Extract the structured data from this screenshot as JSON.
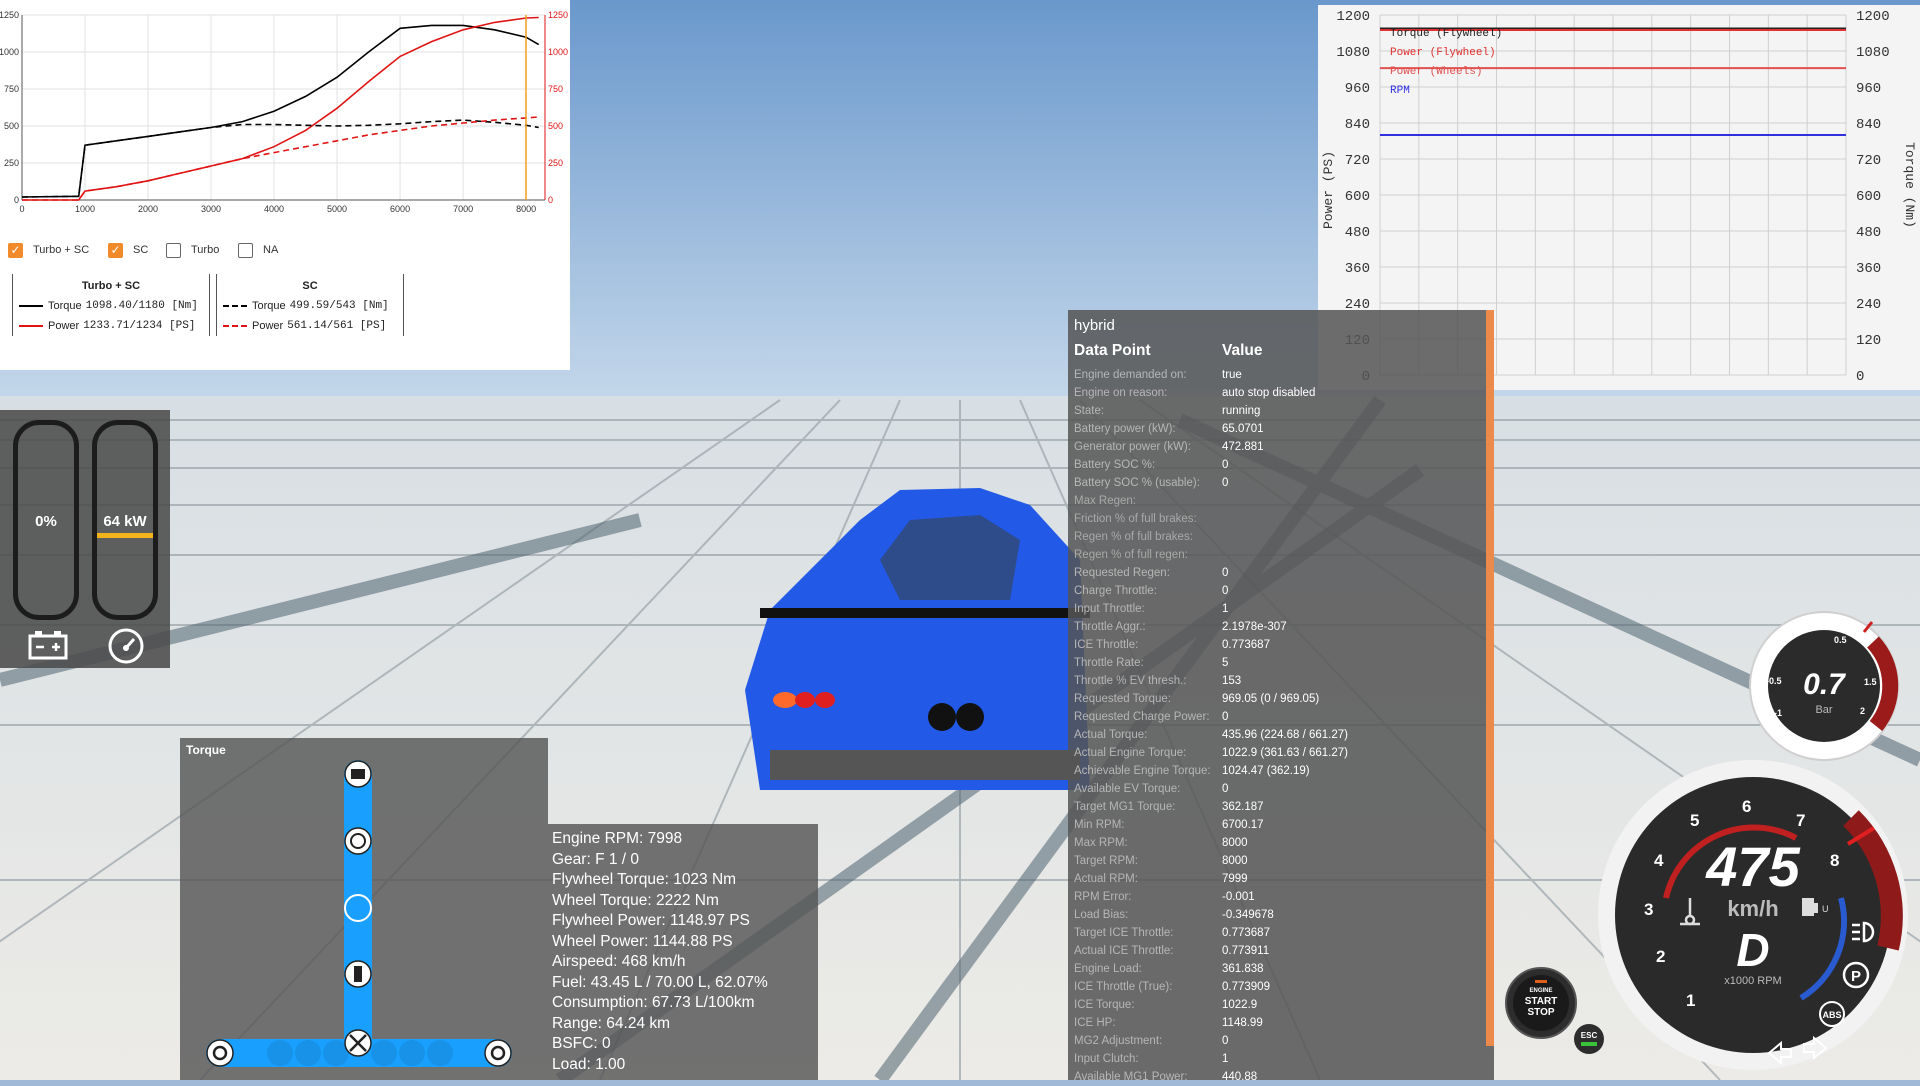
{
  "dyno": {
    "x_ticks": [
      "0",
      "1000",
      "2000",
      "3000",
      "4000",
      "5000",
      "6000",
      "7000",
      "8000"
    ],
    "y_left_ticks": [
      "0",
      "250",
      "500",
      "750",
      "1000",
      "1250"
    ],
    "y_right_ticks": [
      "0",
      "250",
      "500",
      "750",
      "1000",
      "1250"
    ],
    "checkboxes": [
      {
        "label": "Turbo + SC",
        "checked": true
      },
      {
        "label": "SC",
        "checked": true
      },
      {
        "label": "Turbo",
        "checked": false
      },
      {
        "label": "NA",
        "checked": false
      }
    ],
    "legend": [
      {
        "title": "Turbo + SC",
        "torque_label": "Torque",
        "torque_value": "1098.40/1180 [Nm]",
        "power_label": "Power",
        "power_value": "1233.71/1234 [PS]"
      },
      {
        "title": "SC",
        "torque_label": "Torque",
        "torque_value": "499.59/543 [Nm]",
        "power_label": "Power",
        "power_value": "561.14/561 [PS]"
      }
    ],
    "colors": {
      "torque": "#000000",
      "power": "#e01414",
      "marker": "#f0a020"
    }
  },
  "chart_data": [
    {
      "type": "line",
      "x": [
        0,
        900,
        1000,
        1500,
        2000,
        2500,
        3000,
        3500,
        4000,
        4500,
        5000,
        5500,
        6000,
        6500,
        7000,
        7500,
        8000,
        8200
      ],
      "series": [
        {
          "name": "Turbo + SC Torque",
          "values": [
            20,
            25,
            370,
            400,
            430,
            460,
            490,
            530,
            600,
            700,
            830,
            1000,
            1160,
            1180,
            1180,
            1150,
            1100,
            1050
          ]
        },
        {
          "name": "Turbo + SC Power",
          "values": [
            0,
            0,
            60,
            90,
            130,
            180,
            230,
            280,
            360,
            470,
            620,
            800,
            970,
            1070,
            1150,
            1200,
            1230,
            1233
          ]
        },
        {
          "name": "SC Torque",
          "values": [
            20,
            25,
            370,
            400,
            430,
            460,
            490,
            510,
            510,
            505,
            500,
            505,
            515,
            530,
            540,
            525,
            505,
            490
          ]
        },
        {
          "name": "SC Power",
          "values": [
            0,
            0,
            60,
            90,
            130,
            180,
            230,
            280,
            320,
            360,
            400,
            440,
            470,
            500,
            520,
            540,
            555,
            561
          ]
        }
      ],
      "xlim": [
        0,
        8300
      ],
      "ylim": [
        0,
        1250
      ],
      "marker_x": 7998,
      "grid": true
    },
    {
      "type": "line",
      "series": [
        {
          "name": "Torque (Flywheel)",
          "values": [
            1023,
            1023
          ]
        },
        {
          "name": "Power (Flywheel)",
          "values": [
            1148.97,
            1148.97
          ]
        },
        {
          "name": "Power (Wheels)",
          "values": [
            1144.88,
            1144.88
          ]
        },
        {
          "name": "RPM",
          "values": [
            7998,
            7998
          ]
        }
      ],
      "ylabel": "Power (PS)",
      "ylabel_right": "Torque (Nm)",
      "y_ticks": [
        "0",
        "120",
        "240",
        "360",
        "480",
        "600",
        "720",
        "840",
        "960",
        "1080",
        "1200"
      ],
      "ylim": [
        0,
        1200
      ],
      "grid": true,
      "legend_position": "top-left"
    }
  ],
  "graph_legend": [
    {
      "label": "Torque (Flywheel)",
      "color": "#222222"
    },
    {
      "label": "Power (Flywheel)",
      "color": "#e03030"
    },
    {
      "label": "Power (Wheels)",
      "color": "#e05050"
    },
    {
      "label": "RPM",
      "color": "#3030e0"
    }
  ],
  "graph_axes": {
    "left_label": "Power (PS)",
    "right_label": "Torque (Nm)"
  },
  "ev_gauges": {
    "battery_label": "0%",
    "power_label": "64 kW",
    "power_level": 0.5,
    "bar_color": "#f3b41b"
  },
  "torque_diagram": {
    "title": "Torque"
  },
  "stats": [
    "Engine RPM: 7998",
    "Gear: F 1 / 0",
    "Flywheel Torque: 1023 Nm",
    "Wheel Torque: 2222 Nm",
    "Flywheel Power: 1148.97 PS",
    "Wheel Power: 1144.88 PS",
    "Airspeed: 468 km/h",
    "Fuel: 43.45 L / 70.00 L, 62.07%",
    "Consumption: 67.73 L/100km",
    "Range: 64.24 km",
    "BSFC: 0",
    "Load: 1.00"
  ],
  "hybrid": {
    "title": "hybrid",
    "col_key": "Data Point",
    "col_value": "Value",
    "rows": [
      {
        "k": "Engine demanded on:",
        "v": "true"
      },
      {
        "k": "Engine on reason:",
        "v": "auto stop disabled"
      },
      {
        "k": "State:",
        "v": "running"
      },
      {
        "k": "Battery power (kW):",
        "v": "65.0701"
      },
      {
        "k": "Generator power (kW):",
        "v": "472.881"
      },
      {
        "k": "Battery SOC %:",
        "v": "0"
      },
      {
        "k": "Battery SOC % (usable):",
        "v": "0"
      },
      {
        "k": "Max Regen:",
        "v": ""
      },
      {
        "k": "Friction % of full brakes:",
        "v": ""
      },
      {
        "k": "Regen % of full brakes:",
        "v": ""
      },
      {
        "k": "Regen % of full regen:",
        "v": ""
      },
      {
        "k": "Requested Regen:",
        "v": "0"
      },
      {
        "k": "Charge Throttle:",
        "v": "0"
      },
      {
        "k": "Input Throttle:",
        "v": "1"
      },
      {
        "k": "Throttle Aggr.:",
        "v": "2.1978e-307"
      },
      {
        "k": "ICE Throttle:",
        "v": "0.773687"
      },
      {
        "k": "Throttle Rate:",
        "v": "5"
      },
      {
        "k": "Throttle % EV thresh.:",
        "v": "153"
      },
      {
        "k": "Requested Torque:",
        "v": "969.05 (0 / 969.05)"
      },
      {
        "k": "Requested Charge Power:",
        "v": "0"
      },
      {
        "k": "Actual Torque:",
        "v": "435.96 (224.68 / 661.27)"
      },
      {
        "k": "Actual Engine Torque:",
        "v": "1022.9 (361.63 / 661.27)"
      },
      {
        "k": "Achievable Engine Torque:",
        "v": "1024.47 (362.19)"
      },
      {
        "k": "Available EV Torque:",
        "v": "0"
      },
      {
        "k": "Target MG1 Torque:",
        "v": "362.187"
      },
      {
        "k": "Min RPM:",
        "v": "6700.17"
      },
      {
        "k": "Max RPM:",
        "v": "8000"
      },
      {
        "k": "Target RPM:",
        "v": "8000"
      },
      {
        "k": "Actual RPM:",
        "v": "7999"
      },
      {
        "k": "RPM Error:",
        "v": "-0.001"
      },
      {
        "k": "Load Bias:",
        "v": "-0.349678"
      },
      {
        "k": "Target ICE Throttle:",
        "v": "0.773687"
      },
      {
        "k": "Actual ICE Throttle:",
        "v": "0.773911"
      },
      {
        "k": "Engine Load:",
        "v": "361.838"
      },
      {
        "k": "ICE Throttle (True):",
        "v": "0.773909"
      },
      {
        "k": "ICE Torque:",
        "v": "1022.9"
      },
      {
        "k": "ICE HP:",
        "v": "1148.99"
      },
      {
        "k": "MG2 Adjustment:",
        "v": "0"
      },
      {
        "k": "Input Clutch:",
        "v": "1"
      },
      {
        "k": "Available MG1 Power:",
        "v": "440.88"
      }
    ]
  },
  "boost": {
    "value": "0.7",
    "unit": "Bar",
    "ticks": [
      "-1",
      "-0.5",
      "0.5",
      "1.5",
      "2"
    ]
  },
  "speedo": {
    "speed": "475",
    "unit": "km/h",
    "gear": "D",
    "rpm_caption": "x1000 RPM",
    "ticks": [
      "1",
      "2",
      "3",
      "4",
      "5",
      "6",
      "7",
      "8"
    ],
    "fuel_mark": "U"
  },
  "engine_button": {
    "line1": "ENGINE",
    "line2": "START",
    "line3": "STOP"
  },
  "esc": {
    "label": "ESC"
  },
  "abs": {
    "label": "ABS"
  },
  "park": {
    "label": "P"
  }
}
